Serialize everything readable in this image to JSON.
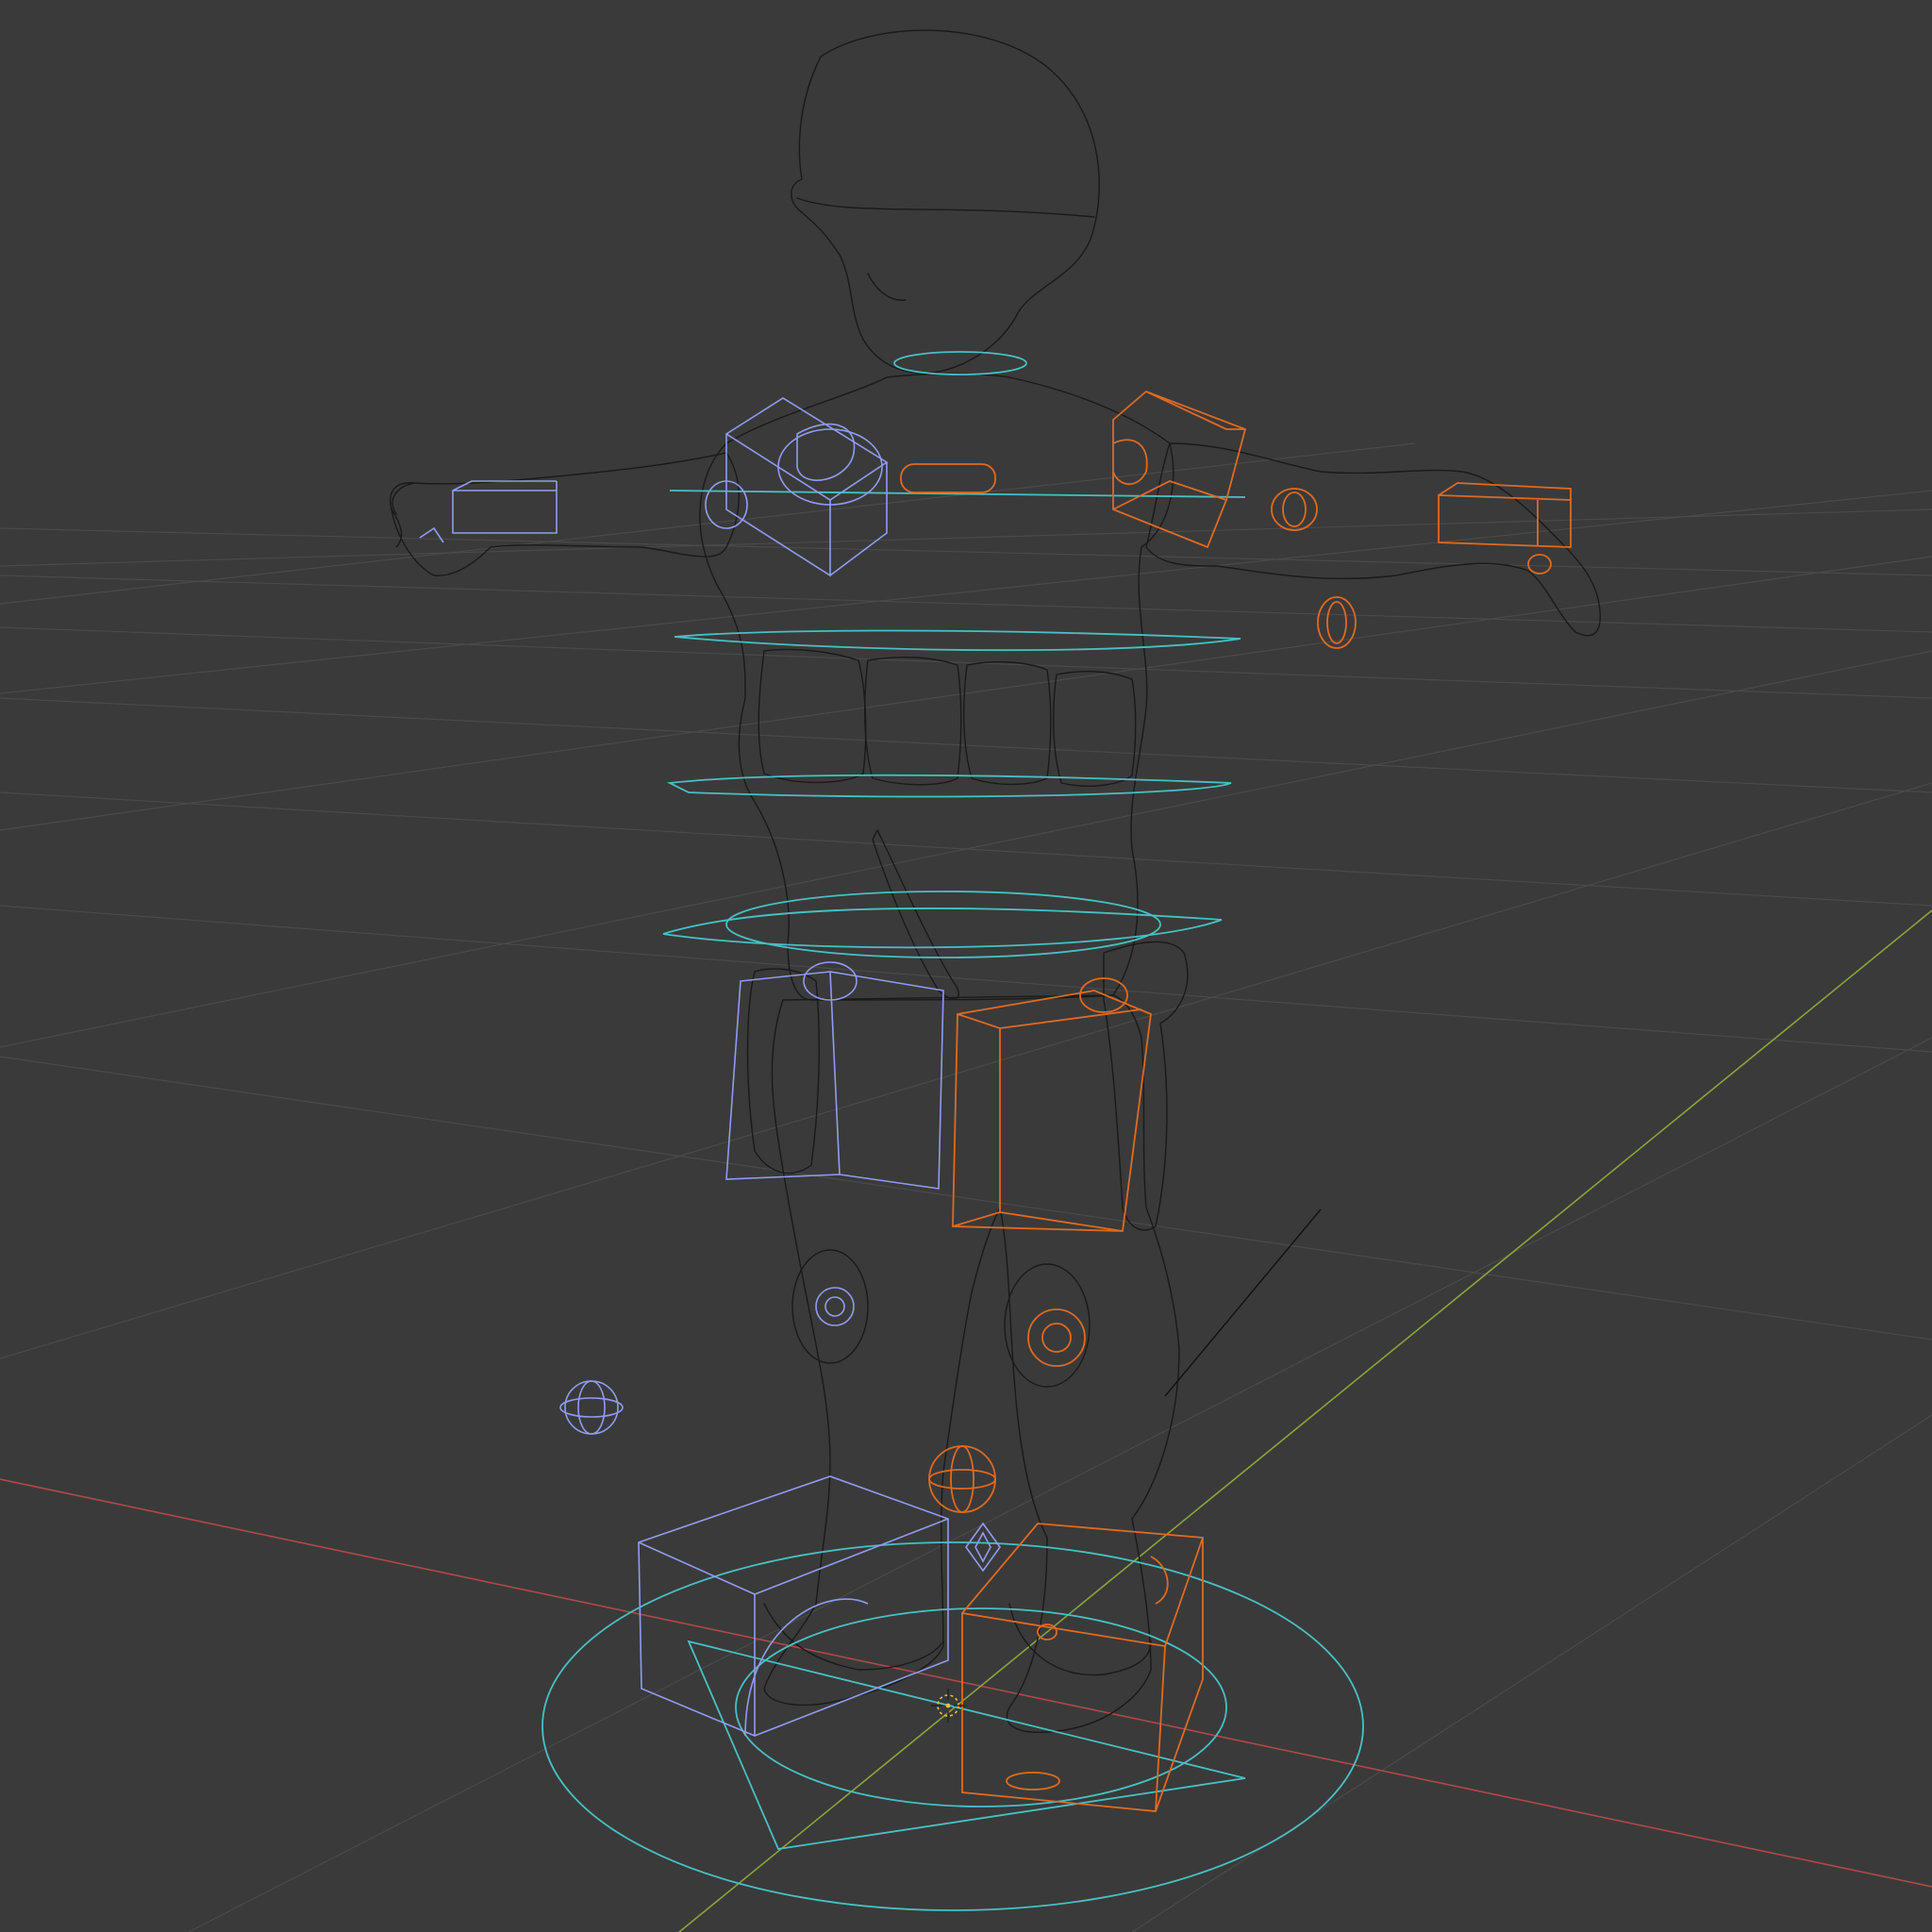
{
  "viewport": {
    "shading": "wireframe",
    "background_color": "#3a3a3a",
    "grid_color": "#4a4a4a",
    "x_axis_color": "#b04848",
    "y_axis_color": "#8aa43a"
  },
  "rig": {
    "mesh_color": "#1a1a1a",
    "left_controls_color": "#8f9cf0",
    "right_controls_color": "#e06a20",
    "center_controls_color": "#48c0c4",
    "bone_line_color": "#111111"
  },
  "cursor": {
    "icon": "3d-cursor-icon",
    "color": "#e8c040"
  }
}
